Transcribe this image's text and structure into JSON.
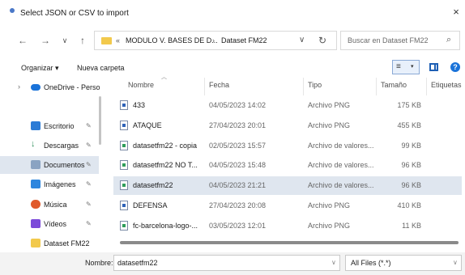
{
  "window": {
    "title": "Select JSON or CSV to import",
    "close_label": "×"
  },
  "nav": {
    "back": "←",
    "forward": "→",
    "recent": "∨",
    "up": "↑",
    "path_sep0": "«",
    "path_part1": "MODULO V. BASES DE D...",
    "path_sep1": "›",
    "path_part2": "Dataset FM22",
    "dropdown": "∨",
    "refresh": "↻",
    "search_placeholder": "Buscar en Dataset FM22",
    "search_icon": "⌕"
  },
  "toolbar": {
    "organize": "Organizar ▾",
    "new_folder": "Nueva carpeta",
    "view_icon": "≡",
    "view_dropdown": "▾",
    "help": "?"
  },
  "sidebar": {
    "expand": "›",
    "items": [
      {
        "label": "OneDrive - Perso",
        "icon": "cloud-icon",
        "color": "#1a73d9"
      },
      {
        "label": "Escritorio",
        "icon": "desktop-icon",
        "color": "#2b7bd6"
      },
      {
        "label": "Descargas",
        "icon": "download-icon",
        "color": "#2f8f5b"
      },
      {
        "label": "Documentos",
        "icon": "documents-icon",
        "color": "#8aa3c2"
      },
      {
        "label": "Imágenes",
        "icon": "pictures-icon",
        "color": "#2e86de"
      },
      {
        "label": "Música",
        "icon": "music-icon",
        "color": "#e05a2b"
      },
      {
        "label": "Vídeos",
        "icon": "videos-icon",
        "color": "#7b4ad9"
      },
      {
        "label": "Dataset FM22",
        "icon": "folder-icon",
        "color": "#f2c94c"
      }
    ],
    "pin": "✎"
  },
  "columns": {
    "name": "Nombre",
    "date": "Fecha",
    "type": "Tipo",
    "size": "Tamaño",
    "tags": "Etiquetas"
  },
  "files": [
    {
      "name": "433",
      "date": "04/05/2023 14:02",
      "type": "Archivo PNG",
      "size": "175 KB"
    },
    {
      "name": "ATAQUE",
      "date": "27/04/2023 20:01",
      "type": "Archivo PNG",
      "size": "455 KB"
    },
    {
      "name": "datasetfm22 - copia",
      "date": "02/05/2023 15:57",
      "type": "Archivo de valores...",
      "size": "99 KB"
    },
    {
      "name": "datasetfm22  NO T...",
      "date": "04/05/2023 15:48",
      "type": "Archivo de valores...",
      "size": "96 KB"
    },
    {
      "name": "datasetfm22",
      "date": "04/05/2023 21:21",
      "type": "Archivo de valores...",
      "size": "96 KB"
    },
    {
      "name": "DEFENSA",
      "date": "27/04/2023 20:08",
      "type": "Archivo PNG",
      "size": "410 KB"
    },
    {
      "name": "fc-barcelona-logo-...",
      "date": "03/05/2023 12:01",
      "type": "Archivo PNG",
      "size": "11 KB"
    }
  ],
  "footer": {
    "name_label": "Nombre:",
    "name_value": "datasetfm22",
    "filetype": "All Files (*.*)",
    "dd": "∨"
  }
}
